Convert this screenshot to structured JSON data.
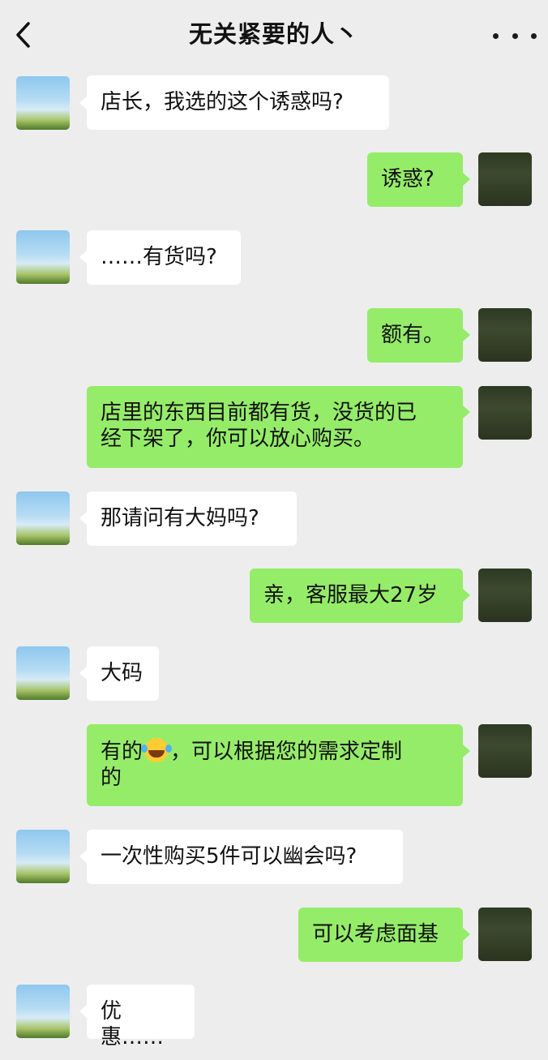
{
  "header": {
    "back_icon": "chevron-left-icon",
    "title": "无关紧要的人丶",
    "more_icon": "more-dots-icon"
  },
  "messages": [
    {
      "side": "in",
      "text": "店长，我选的这个诱惑吗?"
    },
    {
      "side": "out",
      "text": "诱惑?"
    },
    {
      "side": "in",
      "text": "……有货吗?"
    },
    {
      "side": "out",
      "text": "额有。"
    },
    {
      "side": "out",
      "text": "店里的东西目前都有货，没货的已\n经下架了，你可以放心购买。"
    },
    {
      "side": "in",
      "text": "那请问有大妈吗?"
    },
    {
      "side": "out",
      "text": "亲，客服最大27岁"
    },
    {
      "side": "in",
      "text": "大码"
    },
    {
      "side": "out",
      "text_before": "有的",
      "emoji": "laughing-crying-emoji",
      "text_after": "，可以根据您的需求定制\n的"
    },
    {
      "side": "in",
      "text": "一次性购买5件可以幽会吗?"
    },
    {
      "side": "out",
      "text": "可以考虑面基"
    },
    {
      "side": "in",
      "text": "优惠……"
    }
  ],
  "colors": {
    "background": "#ededed",
    "incoming_bubble": "#ffffff",
    "outgoing_bubble": "#95ec69"
  }
}
